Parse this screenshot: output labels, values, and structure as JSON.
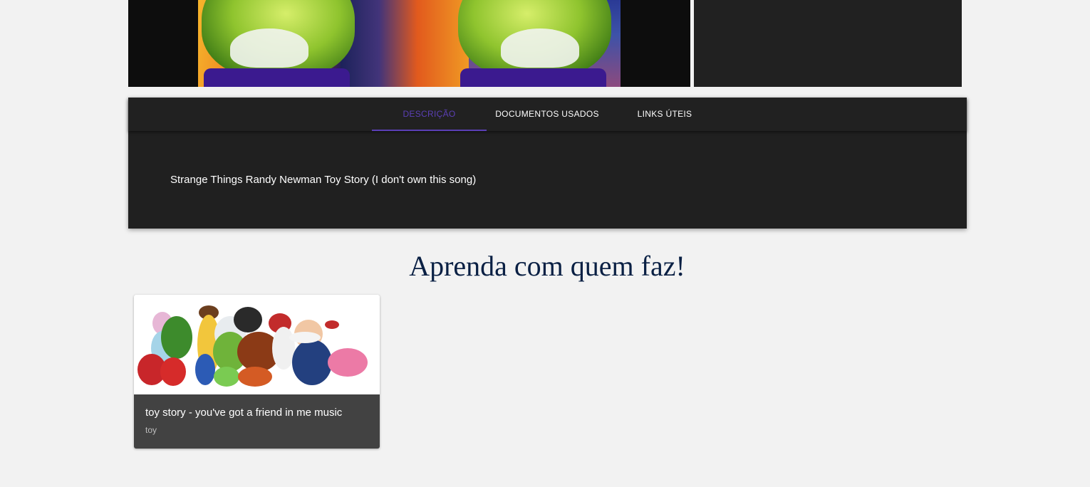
{
  "tabs": [
    {
      "label": "DESCRIÇÃO",
      "active": true
    },
    {
      "label": "DOCUMENTOS USADOS",
      "active": false
    },
    {
      "label": "LINKS ÚTEIS",
      "active": false
    }
  ],
  "description": "Strange Things Randy Newman Toy Story (I don't own this song)",
  "section_heading": "Aprenda com quem faz!",
  "cards": [
    {
      "title": "toy story - you've got a friend in me music",
      "subtitle": "toy"
    }
  ],
  "colors": {
    "accent": "#5b3fb6",
    "heading": "#0a2044",
    "card_bg": "#424242",
    "panel_bg": "#202020"
  }
}
